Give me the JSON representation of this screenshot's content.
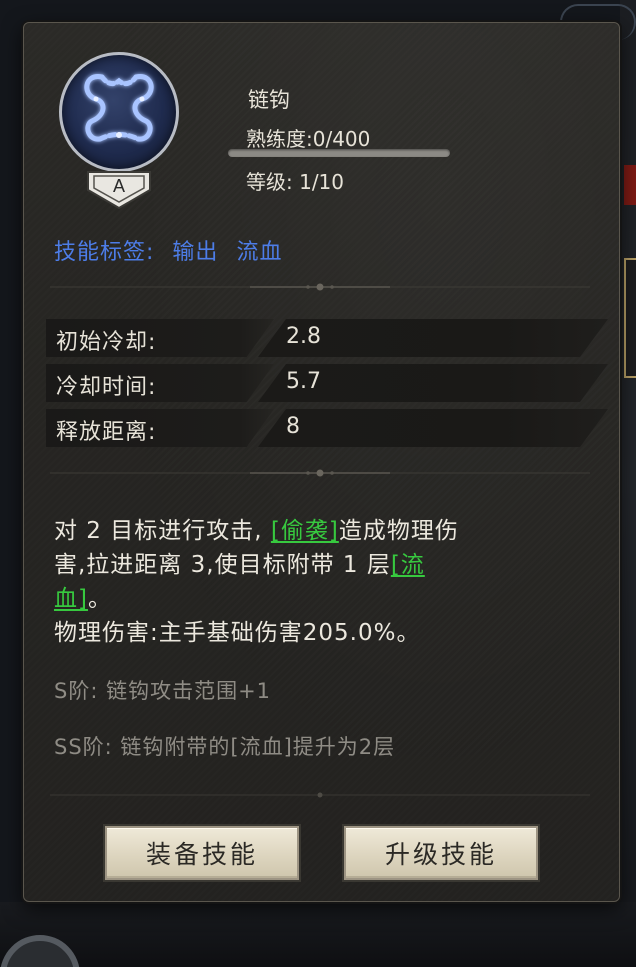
{
  "skill": {
    "name": "链钩",
    "proficiency_text": "熟练度:0/400",
    "proficiency_fraction": 0.0,
    "level_text": "等级: 1/10",
    "rank": "A",
    "icon": "chain-hook-icon"
  },
  "tags": {
    "label": "技能标签:",
    "items": [
      "输出",
      "流血"
    ]
  },
  "stats": [
    {
      "label": "初始冷却:",
      "value": "2.8"
    },
    {
      "label": "冷却时间:",
      "value": "5.7"
    },
    {
      "label": "释放距离:",
      "value": "8"
    }
  ],
  "description": {
    "line1_a": "对 2 目标进行攻击,",
    "line1_kw": "[偷袭]",
    "line1_b": "造成物理伤",
    "line2_a": "害,拉进距离 3,使目标附带 1 层",
    "line2_kw": "[流",
    "line3_kw": "血]",
    "line3_b": "。",
    "line4": "物理伤害:主手基础伤害205.0%。"
  },
  "tiers": {
    "s": "S阶: 链钩攻击范围+1",
    "ss": "SS阶: 链钩附带的[流血]提升为2层"
  },
  "buttons": {
    "equip": "装备技能",
    "upgrade": "升级技能"
  },
  "colors": {
    "tag_blue": "#4d7de8",
    "keyword_green": "#37c93f",
    "text_light": "#e7e3d8",
    "tier_gray": "#8f8c85",
    "button_face": "#e6dfcb"
  }
}
